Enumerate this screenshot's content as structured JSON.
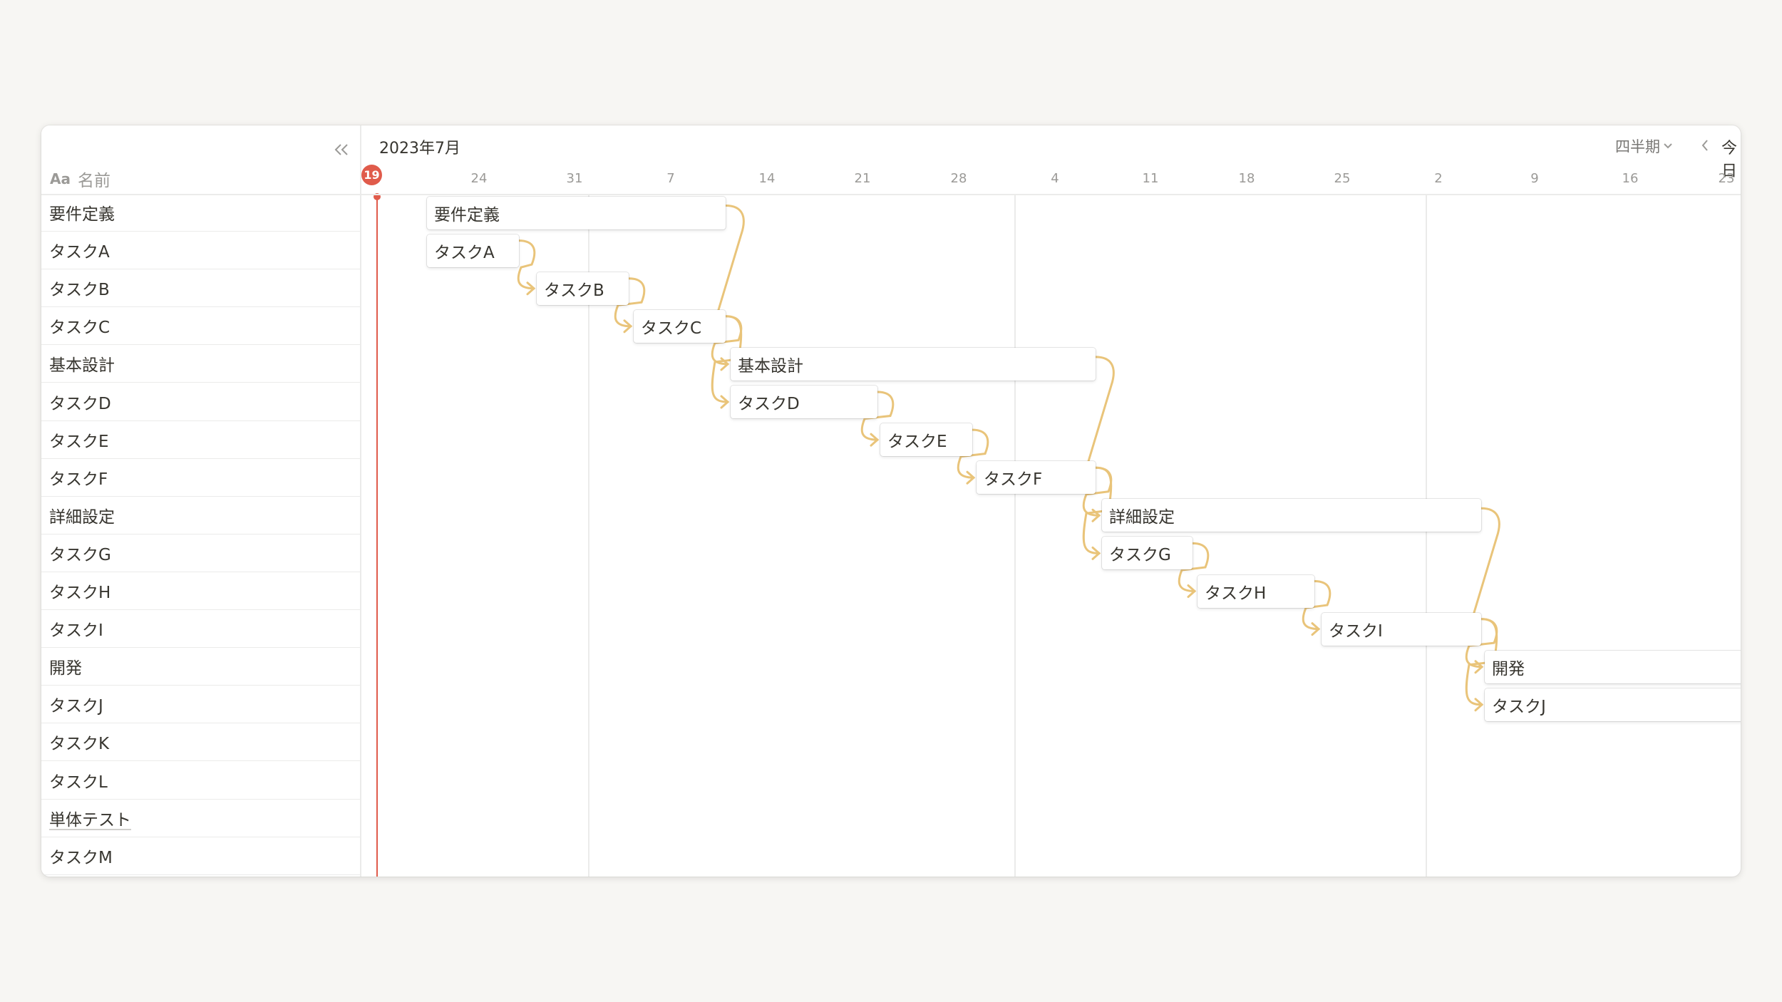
{
  "sidebar": {
    "property_icon": "Aa",
    "name_header": "名前",
    "collapse_icon": "double-chevron-left-icon"
  },
  "timeline": {
    "month_label": "2023年7月",
    "period_select": "四半期",
    "today_label": "今日",
    "today_date": "19",
    "date_ticks": [
      "24",
      "31",
      "7",
      "14",
      "21",
      "28",
      "4",
      "11",
      "18",
      "25",
      "2",
      "9",
      "16",
      "23"
    ],
    "dependency_color": "#e9c47a",
    "today_color": "#e05b4b"
  },
  "rows": [
    {
      "label": "要件定義",
      "underlined": false
    },
    {
      "label": "タスクA",
      "underlined": false
    },
    {
      "label": "タスクB",
      "underlined": false
    },
    {
      "label": "タスクC",
      "underlined": false
    },
    {
      "label": "基本設計",
      "underlined": false
    },
    {
      "label": "タスクD",
      "underlined": false
    },
    {
      "label": "タスクE",
      "underlined": false
    },
    {
      "label": "タスクF",
      "underlined": false
    },
    {
      "label": "詳細設定",
      "underlined": false
    },
    {
      "label": "タスクG",
      "underlined": false
    },
    {
      "label": "タスクH",
      "underlined": false
    },
    {
      "label": "タスクI",
      "underlined": false
    },
    {
      "label": "開発",
      "underlined": false
    },
    {
      "label": "タスクJ",
      "underlined": false
    },
    {
      "label": "タスクK",
      "underlined": false
    },
    {
      "label": "タスクL",
      "underlined": false
    },
    {
      "label": "単体テスト",
      "underlined": true
    },
    {
      "label": "タスクM",
      "underlined": false
    }
  ],
  "bars": [
    {
      "label": "要件定義",
      "row": 0
    },
    {
      "label": "タスクA",
      "row": 1
    },
    {
      "label": "タスクB",
      "row": 2
    },
    {
      "label": "タスクC",
      "row": 3
    },
    {
      "label": "基本設計",
      "row": 4
    },
    {
      "label": "タスクD",
      "row": 5
    },
    {
      "label": "タスクE",
      "row": 6
    },
    {
      "label": "タスクF",
      "row": 7
    },
    {
      "label": "詳細設定",
      "row": 8
    },
    {
      "label": "タスクG",
      "row": 9
    },
    {
      "label": "タスクH",
      "row": 10
    },
    {
      "label": "タスクI",
      "row": 11
    },
    {
      "label": "開発",
      "row": 12
    },
    {
      "label": "タスクJ",
      "row": 13
    }
  ]
}
